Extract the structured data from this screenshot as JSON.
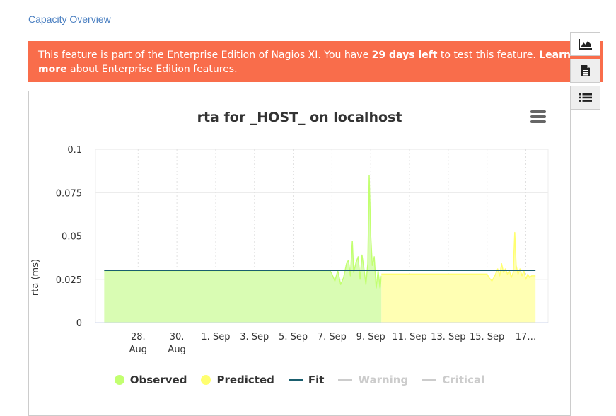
{
  "breadcrumb": {
    "label": "Capacity Overview"
  },
  "banner": {
    "part1": "This feature is part of the Enterprise Edition of Nagios XI. You have ",
    "days_left": "29 days left",
    "part2": " to test this feature. ",
    "learn_more": "Learn more",
    "part3": " about Enterprise Edition features."
  },
  "side_buttons": [
    {
      "icon": "area-chart-icon"
    },
    {
      "icon": "document-icon"
    },
    {
      "icon": "list-icon"
    }
  ],
  "chart_data": {
    "type": "area",
    "title": "rta for _HOST_ on localhost",
    "ylabel": "rta (ms)",
    "xlabel": "",
    "ylim": [
      0,
      0.1
    ],
    "yticks": [
      "0",
      "0.025",
      "0.05",
      "0.075",
      "0.1"
    ],
    "xticks": [
      {
        "day": 2,
        "label": [
          "28.",
          "Aug"
        ]
      },
      {
        "day": 4,
        "label": [
          "30.",
          "Aug"
        ]
      },
      {
        "day": 6,
        "label": [
          "1. Sep"
        ]
      },
      {
        "day": 8,
        "label": [
          "3. Sep"
        ]
      },
      {
        "day": 10,
        "label": [
          "5. Sep"
        ]
      },
      {
        "day": 12,
        "label": [
          "7. Sep"
        ]
      },
      {
        "day": 14,
        "label": [
          "9. Sep"
        ]
      },
      {
        "day": 16,
        "label": [
          "11. Sep"
        ]
      },
      {
        "day": 18,
        "label": [
          "13. Sep"
        ]
      },
      {
        "day": 20,
        "label": [
          "15. Sep"
        ]
      },
      {
        "day": 22,
        "label": [
          "17…"
        ]
      }
    ],
    "xlim": [
      -0.2,
      23.15
    ],
    "grid": true,
    "series": [
      {
        "name": "Observed",
        "color": "#c2ff70",
        "fill": "#d9fcb3",
        "points": [
          [
            0.25,
            0.03
          ],
          [
            11.9,
            0.03
          ],
          [
            12.0,
            0.028
          ],
          [
            12.15,
            0.024
          ],
          [
            12.3,
            0.03
          ],
          [
            12.45,
            0.022
          ],
          [
            12.6,
            0.026
          ],
          [
            12.75,
            0.034
          ],
          [
            12.85,
            0.036
          ],
          [
            12.95,
            0.027
          ],
          [
            13.05,
            0.047
          ],
          [
            13.12,
            0.029
          ],
          [
            13.25,
            0.035
          ],
          [
            13.35,
            0.038
          ],
          [
            13.45,
            0.025
          ],
          [
            13.55,
            0.039
          ],
          [
            13.65,
            0.031
          ],
          [
            13.75,
            0.022
          ],
          [
            13.85,
            0.034
          ],
          [
            13.92,
            0.085
          ],
          [
            14.0,
            0.05
          ],
          [
            14.08,
            0.033
          ],
          [
            14.18,
            0.038
          ],
          [
            14.28,
            0.02
          ],
          [
            14.38,
            0.03
          ],
          [
            14.48,
            0.02
          ],
          [
            14.55,
            0.027
          ]
        ]
      },
      {
        "name": "Predicted",
        "color": "#ffff70",
        "fill": "#ffffb3",
        "points": [
          [
            14.55,
            0.028
          ],
          [
            20.0,
            0.028
          ],
          [
            20.1,
            0.026
          ],
          [
            20.25,
            0.024
          ],
          [
            20.4,
            0.027
          ],
          [
            20.55,
            0.031
          ],
          [
            20.65,
            0.027
          ],
          [
            20.75,
            0.034
          ],
          [
            20.85,
            0.029
          ],
          [
            20.95,
            0.031
          ],
          [
            21.05,
            0.028
          ],
          [
            21.15,
            0.03
          ],
          [
            21.25,
            0.026
          ],
          [
            21.35,
            0.029
          ],
          [
            21.43,
            0.052
          ],
          [
            21.5,
            0.033
          ],
          [
            21.6,
            0.028
          ],
          [
            21.7,
            0.031
          ],
          [
            21.8,
            0.027
          ],
          [
            21.9,
            0.03
          ],
          [
            22.0,
            0.025
          ],
          [
            22.1,
            0.028
          ],
          [
            22.2,
            0.026
          ],
          [
            22.3,
            0.027
          ],
          [
            22.5,
            0.027
          ]
        ]
      },
      {
        "name": "Fit",
        "color": "#1a5e6e",
        "points": [
          [
            0.25,
            0.0302
          ],
          [
            22.5,
            0.0302
          ]
        ]
      }
    ],
    "legend": [
      {
        "name": "Observed",
        "marker": "dot",
        "color": "#c2ff70",
        "visible": true
      },
      {
        "name": "Predicted",
        "marker": "dot",
        "color": "#ffff70",
        "visible": true
      },
      {
        "name": "Fit",
        "marker": "line",
        "color": "#1a5e6e",
        "visible": true
      },
      {
        "name": "Warning",
        "marker": "line",
        "color": "#cccccc",
        "visible": false
      },
      {
        "name": "Critical",
        "marker": "line",
        "color": "#cccccc",
        "visible": false
      }
    ],
    "legend_position": "bottom-center"
  }
}
